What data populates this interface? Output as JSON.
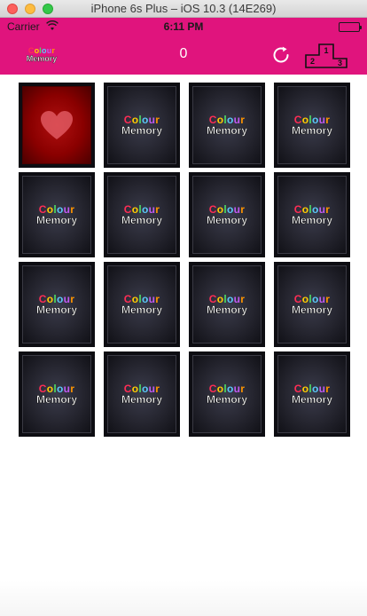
{
  "window": {
    "title": "iPhone 6s Plus – iOS 10.3 (14E269)"
  },
  "status_bar": {
    "carrier": "Carrier",
    "time": "6:11 PM",
    "icons": [
      "wifi-icon",
      "battery-icon"
    ]
  },
  "nav_bar": {
    "logo": {
      "line1": "Colour",
      "line2": "Memory"
    },
    "score": "0",
    "icons": [
      "restart-icon",
      "leaderboard-podium-icon"
    ],
    "podium_labels": [
      "1",
      "2",
      "3"
    ],
    "color": "#e0147d"
  },
  "card_logo": {
    "line1": "Colour",
    "line2": "Memory",
    "letter_colors": [
      "#ff2d55",
      "#ffcc00",
      "#4cd964",
      "#5ac8fa",
      "#bf5af2",
      "#ff9500"
    ]
  },
  "grid": {
    "rows": 4,
    "columns": 4,
    "cards": [
      {
        "state": "revealed",
        "face": "heart"
      },
      {
        "state": "hidden"
      },
      {
        "state": "hidden"
      },
      {
        "state": "hidden"
      },
      {
        "state": "hidden"
      },
      {
        "state": "hidden"
      },
      {
        "state": "hidden"
      },
      {
        "state": "hidden"
      },
      {
        "state": "hidden"
      },
      {
        "state": "hidden"
      },
      {
        "state": "hidden"
      },
      {
        "state": "hidden"
      },
      {
        "state": "hidden"
      },
      {
        "state": "hidden"
      },
      {
        "state": "hidden"
      },
      {
        "state": "hidden"
      }
    ]
  }
}
